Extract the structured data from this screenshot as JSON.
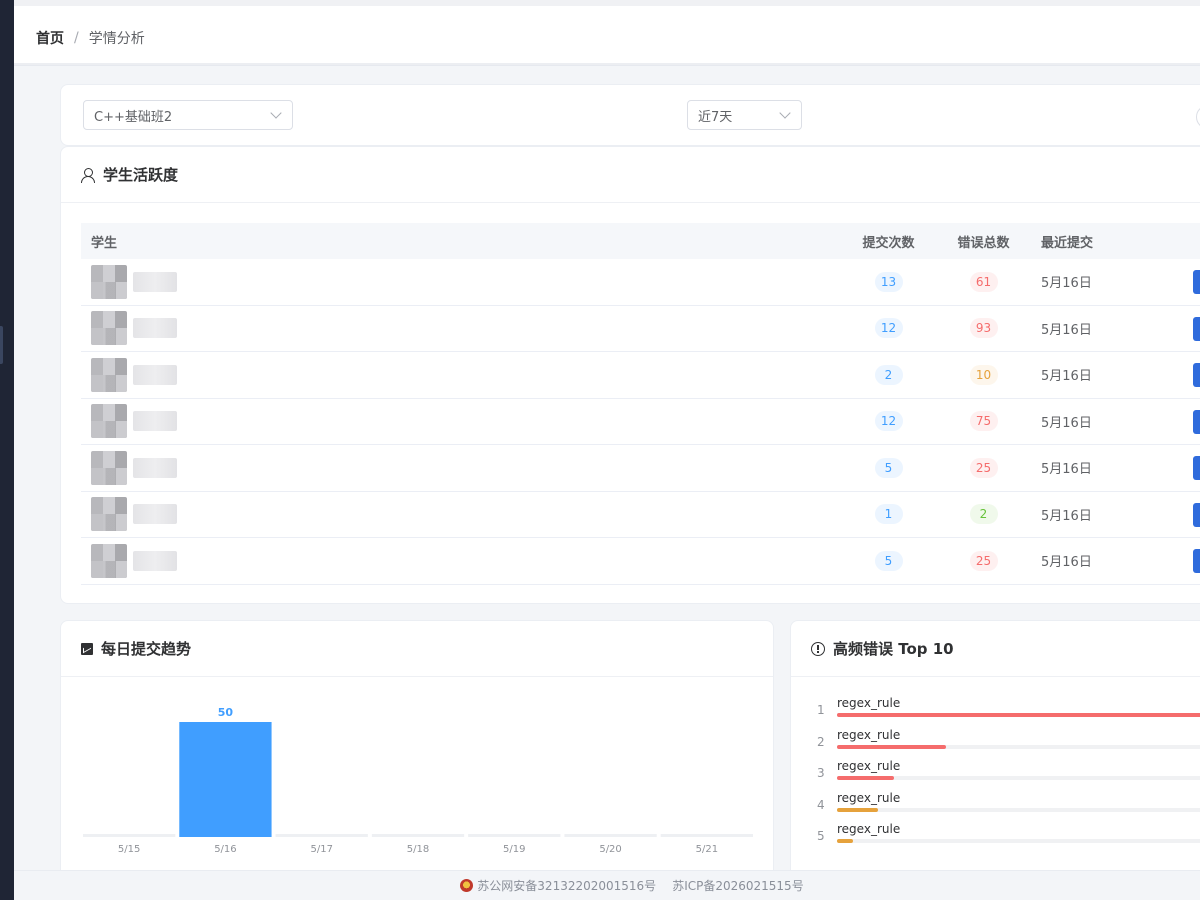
{
  "breadcrumb": {
    "home": "首页",
    "separator": "/",
    "current": "学情分析"
  },
  "filters": {
    "class_select": {
      "value": "C++基础班2"
    },
    "range_select": {
      "value": "近7天"
    }
  },
  "activity": {
    "title": "学生活跃度",
    "columns": {
      "student": "学生",
      "submissions": "提交次数",
      "errors": "错误总数",
      "last": "最近提交"
    },
    "rows": [
      {
        "submissions": "13",
        "errors": "61",
        "errors_level": "red",
        "last": "5月16日"
      },
      {
        "submissions": "12",
        "errors": "93",
        "errors_level": "red",
        "last": "5月16日"
      },
      {
        "submissions": "2",
        "errors": "10",
        "errors_level": "orange",
        "last": "5月16日"
      },
      {
        "submissions": "12",
        "errors": "75",
        "errors_level": "red",
        "last": "5月16日"
      },
      {
        "submissions": "5",
        "errors": "25",
        "errors_level": "red",
        "last": "5月16日"
      },
      {
        "submissions": "1",
        "errors": "2",
        "errors_level": "green",
        "last": "5月16日"
      },
      {
        "submissions": "5",
        "errors": "25",
        "errors_level": "red",
        "last": "5月16日"
      }
    ]
  },
  "trend": {
    "title": "每日提交趋势",
    "chart_data": {
      "type": "bar",
      "categories": [
        "5/15",
        "5/16",
        "5/17",
        "5/18",
        "5/19",
        "5/20",
        "5/21"
      ],
      "values": [
        0,
        50,
        0,
        0,
        0,
        0,
        0
      ],
      "value_labels": [
        "",
        "50",
        "",
        "",
        "",
        "",
        ""
      ],
      "bar_color": "#409eff",
      "empty_color": "#eef0f3"
    }
  },
  "top_errors": {
    "title": "高频错误 Top 10",
    "items": [
      {
        "rank": "1",
        "label": "regex_rule",
        "ratio": 1.0,
        "color": "#f56c6c"
      },
      {
        "rank": "2",
        "label": "regex_rule",
        "ratio": 0.28,
        "color": "#f56c6c"
      },
      {
        "rank": "3",
        "label": "regex_rule",
        "ratio": 0.145,
        "color": "#f56c6c"
      },
      {
        "rank": "4",
        "label": "regex_rule",
        "ratio": 0.105,
        "color": "#e6a23c"
      },
      {
        "rank": "5",
        "label": "regex_rule",
        "ratio": 0.04,
        "color": "#e6a23c"
      }
    ]
  },
  "footer": {
    "police": "苏公网安备32132202001516号",
    "icp": "苏ICP备2026021515号"
  }
}
